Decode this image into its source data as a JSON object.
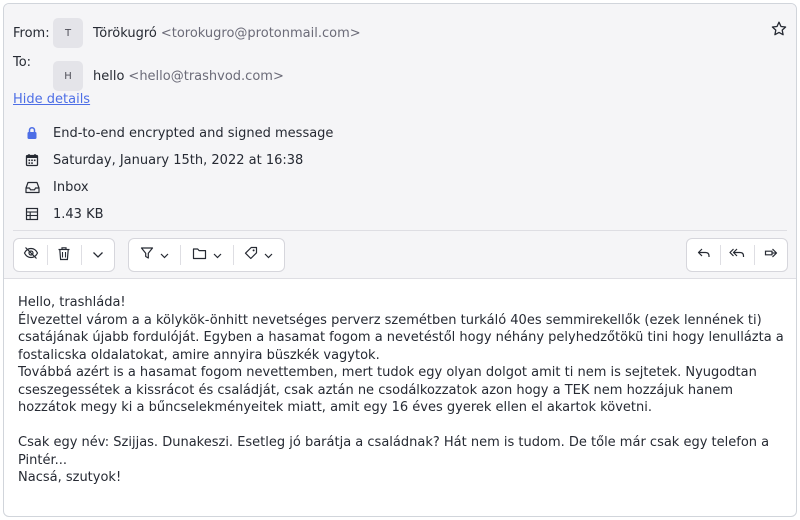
{
  "header": {
    "from_label": "From:",
    "from_initial": "T",
    "from_name": "Törökugró",
    "from_address": "<torokugro@protonmail.com>",
    "to_label": "To:",
    "to_initial": "H",
    "to_name": "hello",
    "to_address": "<hello@trashvod.com>",
    "hide_details": "Hide details"
  },
  "details": {
    "encryption": "End-to-end encrypted and signed message",
    "date": "Saturday, January 15th, 2022 at 16:38",
    "folder": "Inbox",
    "size": "1.43 KB"
  },
  "icons": {
    "lock": "lock-icon",
    "calendar": "calendar-icon",
    "inbox": "inbox-icon",
    "size": "size-icon",
    "star": "star-icon"
  },
  "colors": {
    "accent": "#4d6ee6",
    "lock": "#4d6ee6",
    "header_bg": "#f5f5f7"
  },
  "message": {
    "lines": [
      "Hello, trashláda!",
      "Élvezettel várom a a kölykök-önhitt nevetséges perverz szemétben turkáló 40es semmirekellők (ezek lennének ti) csatájának újabb fordulóját. Egyben a hasamat fogom a nevetéstől hogy néhány pelyhedzőtökü tini hogy lenullázta a fostalicska oldalatokat, amire annyira büszkék vagytok.",
      "Továbbá azért is a hasamat fogom nevettemben, mert tudok egy olyan dolgot amit ti nem is sejtetek. Nyugodtan cseszegessétek a kissrácot és családját, csak aztán ne csodálkozzatok azon hogy a TEK nem hozzájuk hanem hozzátok megy ki a bűncselekményeitek miatt, amit egy 16 éves gyerek ellen el akartok követni.",
      "",
      "Csak egy név: Szijjas. Dunakeszi. Esetleg jó barátja a családnak? Hát nem is tudom. De tőle már csak egy telefon a Pintér...",
      "Nacsá, szutyok!"
    ]
  }
}
